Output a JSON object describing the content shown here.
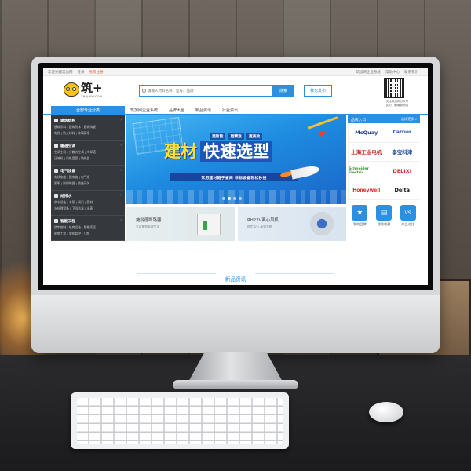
{
  "topbar": {
    "welcome": "欢迎光临筑加网",
    "login": "登录",
    "register": "免费注册",
    "right_links": [
      "筑加网企业系统",
      "帮助中心",
      "联系我们"
    ]
  },
  "logo": {
    "text": "筑+",
    "sub": "ZHUJIAW.COM"
  },
  "search": {
    "placeholder": "请输入材料名称、型号、品牌",
    "button": "搜索"
  },
  "publish": {
    "label": "我也发布"
  },
  "qr": {
    "caption_line1": "关注筑加网公众号",
    "caption_line2": "实时了解最新消息"
  },
  "nav": {
    "all_categories": "全部专业分类",
    "items": [
      "筑加网企业系统",
      "品牌大全",
      "新品资讯",
      "行业资讯"
    ]
  },
  "sidebar": {
    "items": [
      {
        "title": "建筑结构",
        "sub1": "建筑涂料 | 建筑防水 | 建筑陶瓷",
        "sub2": "电梯 | 防火材料 | 玻璃幕墙"
      },
      {
        "title": "暖通空调",
        "sub1": "空调主机 | 分散式空调 | 冷却塔",
        "sub2": "压缩机 | 风机盘管 | 散热器"
      },
      {
        "title": "电气设备",
        "sub1": "电线电缆 | 配电箱 | 电气柜",
        "sub2": "照明 | 防爆电器 | 插座开关"
      },
      {
        "title": "给排水",
        "sub1": "供水设备 | 水泵 | 阀门 | 管材",
        "sub2": "水处理设备 | 卫浴洁具 | 水表"
      },
      {
        "title": "智能工程",
        "sub1": "楼宇控制 | 机房设备 | 智能家居",
        "sub2": "机房工程 | 安防监控 | 门禁"
      }
    ]
  },
  "banner": {
    "tags": [
      "更智能",
      "更精准",
      "更高效"
    ],
    "headline_left": "建材",
    "headline_right": "快速选型",
    "ribbon": "常用建材随手查阅  非标设备轻松秒搜",
    "slides": 4,
    "active_slide": 2
  },
  "promos": [
    {
      "title": "施耐德断路器",
      "sub": "全球能效管理专家"
    },
    {
      "title": "RH22V离心风机",
      "sub": "稳定运行  高效节能"
    }
  ],
  "brands": {
    "header": "品牌入口",
    "more": "选择更多 ▾",
    "items": [
      {
        "name": "McQuay",
        "color": "#1e3a8a"
      },
      {
        "name": "Carrier",
        "color": "#1f4fa8"
      },
      {
        "name": "上海工业电机",
        "color": "#c0302b"
      },
      {
        "name": "泰宝科津",
        "color": "#1d4e9a"
      },
      {
        "name": "Schneider Electric",
        "color": "#3a9a3a"
      },
      {
        "name": "DELIXI",
        "color": "#d6312a"
      },
      {
        "name": "Honeywell",
        "color": "#d6312a"
      },
      {
        "name": "Delta",
        "color": "#111111"
      }
    ]
  },
  "quick_links": [
    {
      "icon": "★",
      "label": "我的品牌",
      "icon_name": "star-icon"
    },
    {
      "icon": "▤",
      "label": "我的收藏",
      "icon_name": "folder-icon"
    },
    {
      "icon": "VS",
      "label": "产品对比",
      "icon_name": "compare-icon"
    }
  ],
  "section": {
    "title": "新品资讯"
  }
}
